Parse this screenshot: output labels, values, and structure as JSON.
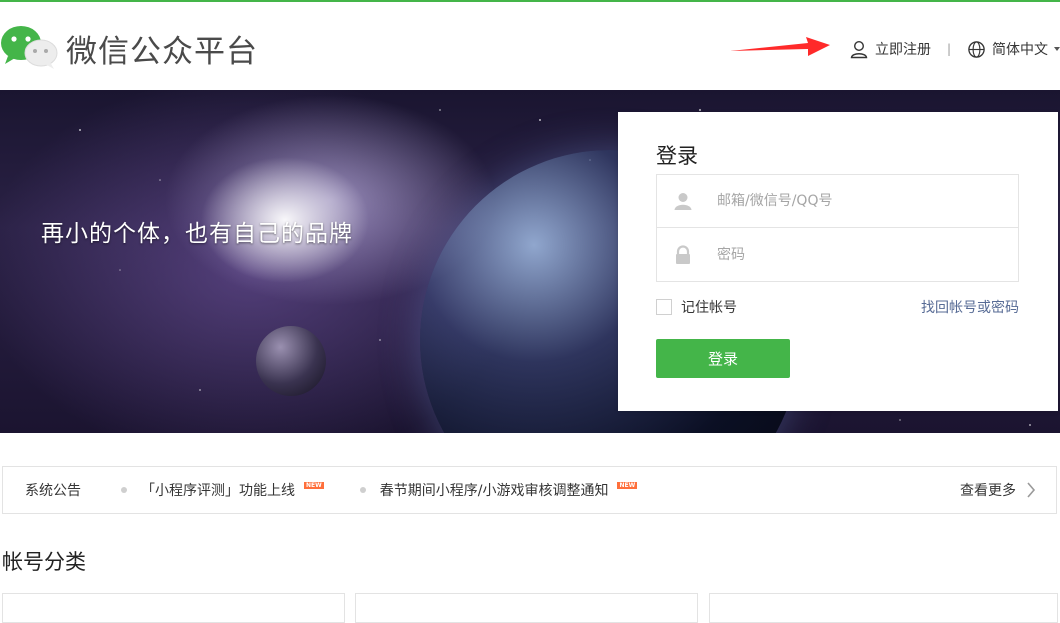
{
  "colors": {
    "accent": "#44b549",
    "link": "#576b95",
    "badge": "#ff6f3b",
    "arrow": "#ff2a2a"
  },
  "header": {
    "brand": "微信公众平台",
    "logo_icon": "wechat-logo-icon",
    "register_label": "立即注册",
    "register_icon": "user-icon",
    "separator": "|",
    "language_label": "简体中文",
    "language_icon": "globe-icon"
  },
  "banner": {
    "slogan": "再小的个体，也有自己的品牌"
  },
  "login": {
    "title": "登录",
    "account_placeholder": "邮箱/微信号/QQ号",
    "account_value": "",
    "password_placeholder": "密码",
    "password_value": "",
    "remember_label": "记住帐号",
    "remember_checked": false,
    "forgot_label": "找回帐号或密码",
    "submit_label": "登录"
  },
  "announcements": {
    "label": "系统公告",
    "items": [
      {
        "text": "「小程序评测」功能上线",
        "badge": "NEW"
      },
      {
        "text": "春节期间小程序/小游戏审核调整通知",
        "badge": "NEW"
      }
    ],
    "more_label": "查看更多"
  },
  "categories": {
    "title": "帐号分类"
  }
}
